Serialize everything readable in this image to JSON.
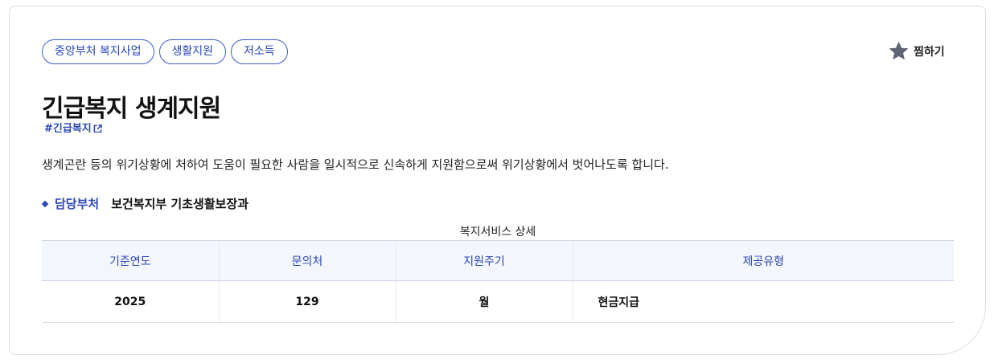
{
  "tags": [
    "중앙부처 복지사업",
    "생활지원",
    "저소득"
  ],
  "favorite": {
    "label": "찜하기",
    "icon": "star-icon"
  },
  "title": "긴급복지 생계지원",
  "hashtag": {
    "label": "#긴급복지",
    "icon": "external-link-icon"
  },
  "description": "생계곤란 등의 위기상황에 처하여 도움이 필요한 사람을 일시적으로 신속하게 지원함으로써 위기상황에서 벗어나도록 합니다.",
  "department": {
    "label": "담당부처",
    "value": "보건복지부 기초생활보장과"
  },
  "table": {
    "caption": "복지서비스 상세",
    "headers": [
      "기준연도",
      "문의처",
      "지원주기",
      "제공유형"
    ],
    "rows": [
      [
        "2025",
        "129",
        "월",
        "현금지급"
      ]
    ]
  },
  "colors": {
    "accent": "#2a47b5",
    "header_bg": "#f3f6fd",
    "star": "#5f6474"
  }
}
